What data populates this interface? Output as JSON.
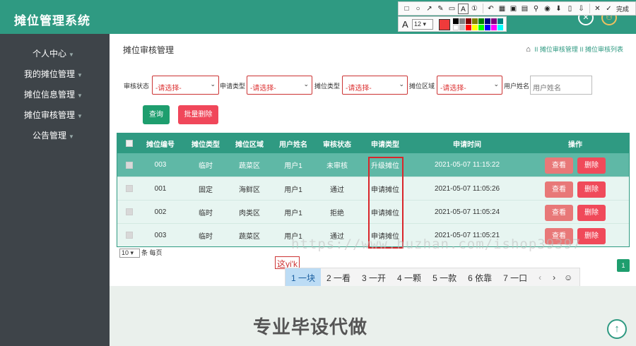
{
  "app_title": "摊位管理系统",
  "colors": {
    "primary": "#2f9a82",
    "sidebar": "#3e4449",
    "danger": "#f0475a",
    "view_btn": "#e87878"
  },
  "sidebar": {
    "items": [
      {
        "label": "个人中心",
        "caret": "▼"
      },
      {
        "label": "我的摊位管理",
        "caret": "▼"
      },
      {
        "label": "摊位信息管理",
        "caret": "▼"
      },
      {
        "label": "摊位审核管理",
        "caret": "▼"
      },
      {
        "label": "公告管理",
        "caret": "▼"
      }
    ]
  },
  "page": {
    "title": "摊位审核管理",
    "breadcrumb": {
      "home_icon": "home-icon",
      "sep": "II",
      "items": [
        "摊位审核管理",
        "摊位审核列表"
      ]
    }
  },
  "filters": {
    "audit_status": {
      "label": "审核状态",
      "value": "-请选择-"
    },
    "apply_type": {
      "label": "申请类型",
      "value": "-请选择-"
    },
    "stall_type": {
      "label": "摊位类型",
      "value": "-请选择-"
    },
    "stall_area": {
      "label": "摊位区域",
      "value": "-请选择-"
    },
    "user_name": {
      "label": "用户姓名",
      "placeholder": "用户姓名"
    }
  },
  "buttons": {
    "query": "查询",
    "batch_delete": "批量删除",
    "view": "查看",
    "delete": "删除"
  },
  "table": {
    "headers": [
      "摊位编号",
      "摊位类型",
      "摊位区域",
      "用户姓名",
      "审核状态",
      "申请类型",
      "申请时间",
      "操作"
    ],
    "rows": [
      [
        "003",
        "临时",
        "蔬菜区",
        "用户1",
        "未审核",
        "升级摊位",
        "2021-05-07 11:15:22"
      ],
      [
        "001",
        "固定",
        "海鲜区",
        "用户1",
        "通过",
        "申请摊位",
        "2021-05-07 11:05:26"
      ],
      [
        "002",
        "临时",
        "肉类区",
        "用户1",
        "拒绝",
        "申请摊位",
        "2021-05-07 11:05:24"
      ],
      [
        "003",
        "临时",
        "蔬菜区",
        "用户1",
        "通过",
        "申请摊位",
        "2021-05-07 11:05:21"
      ]
    ]
  },
  "pagination": {
    "per_page": "10",
    "per_page_label": "条 每页",
    "current_page": "1"
  },
  "ime": {
    "composition": "这yi'k",
    "candidates": [
      "1 一块",
      "2 一看",
      "3 一开",
      "4 一颗",
      "5 一款",
      "6 依靠",
      "7 一口"
    ],
    "prev": "‹",
    "next": "›",
    "emoji": "☺"
  },
  "footer": {
    "text": "专业毕设代做"
  },
  "watermark": "https://www.huzhan.com/ishop39397",
  "screenshot_tool": {
    "done_label": "完成",
    "font_size": "12"
  }
}
